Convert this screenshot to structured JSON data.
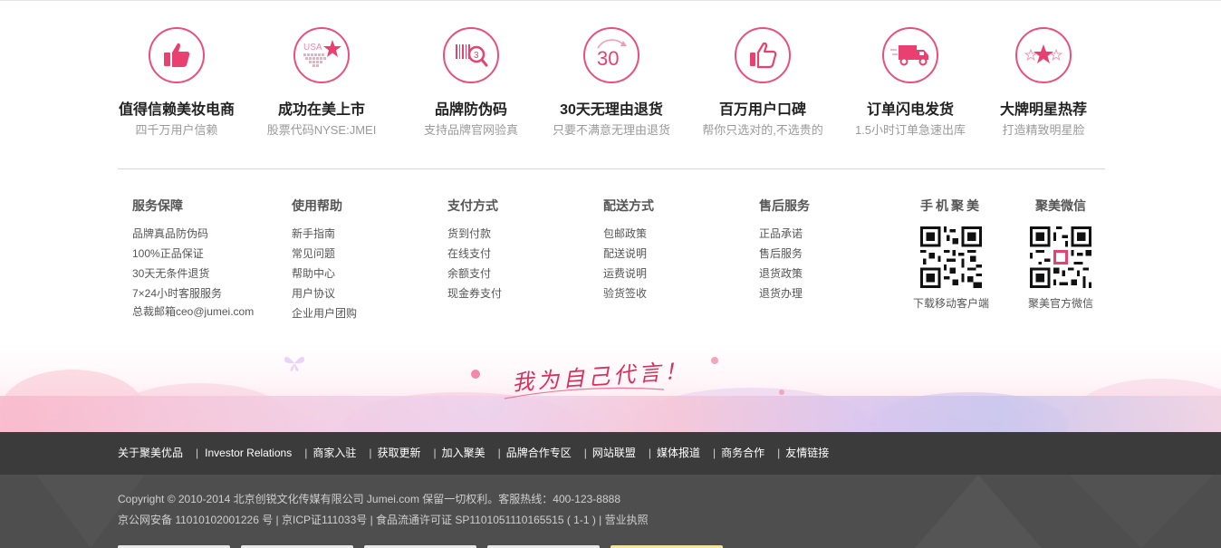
{
  "features": [
    {
      "icon": "thumbs-up-icon",
      "title": "值得信赖美妆电商",
      "subtitle": "四千万用户信赖"
    },
    {
      "icon": "usa-star-icon",
      "title": "成功在美上市",
      "subtitle": "股票代码NYSE:JMEI",
      "icon_text": "USA"
    },
    {
      "icon": "barcode-magnifier-icon",
      "title": "品牌防伪码",
      "subtitle": "支持品牌官网验真"
    },
    {
      "icon": "thirty-days-icon",
      "title": "30天无理由退货",
      "subtitle": "只要不满意无理由退货",
      "icon_text": "30"
    },
    {
      "icon": "thumbs-up-outline-icon",
      "title": "百万用户口碑",
      "subtitle": "帮你只选对的,不选贵的"
    },
    {
      "icon": "delivery-truck-icon",
      "title": "订单闪电发货",
      "subtitle": "1.5小时订单急速出库"
    },
    {
      "icon": "star-icon",
      "title": "大牌明星热荐",
      "subtitle": "打造精致明星脸"
    }
  ],
  "columns": [
    {
      "title": "服务保障",
      "links": [
        "品牌真品防伪码",
        "100%正品保证",
        "30天无条件退货",
        "7×24小时客服服务",
        "总裁邮箱ceo@jumei.com"
      ]
    },
    {
      "title": "使用帮助",
      "links": [
        "新手指南",
        "常见问题",
        "帮助中心",
        "用户协议",
        "企业用户团购"
      ]
    },
    {
      "title": "支付方式",
      "links": [
        "货到付款",
        "在线支付",
        "余额支付",
        "现金券支付"
      ]
    },
    {
      "title": "配送方式",
      "links": [
        "包邮政策",
        "配送说明",
        "运费说明",
        "验货签收"
      ]
    },
    {
      "title": "售后服务",
      "links": [
        "正品承诺",
        "售后服务",
        "退货政策",
        "退货办理"
      ]
    }
  ],
  "qr_codes": [
    {
      "title": "手机聚美",
      "caption": "下载移动客户端"
    },
    {
      "title": "聚美微信",
      "caption": "聚美官方微信"
    }
  ],
  "banner": {
    "slogan": "我为自己代言！"
  },
  "nav_links": [
    "关于聚美优品",
    "Investor Relations",
    "商家入驻",
    "获取更新",
    "加入聚美",
    "品牌合作专区",
    "网站联盟",
    "媒体报道",
    "商务合作",
    "友情链接"
  ],
  "footer": {
    "copyright": "Copyright © 2010-2014 北京创锐文化传媒有限公司 Jumei.com 保留一切权利。客服热线：400-123-8888",
    "licenses": "京公网安备 11010102001226 号 | 京ICP证111033号 | 食品流通许可证 SP1101051110165515 ( 1-1 ) | 营业执照"
  },
  "colors": {
    "accent": "#ea4f7c",
    "nav_bg": "#3b3b3b",
    "footer_bg": "#4e4e4e"
  }
}
